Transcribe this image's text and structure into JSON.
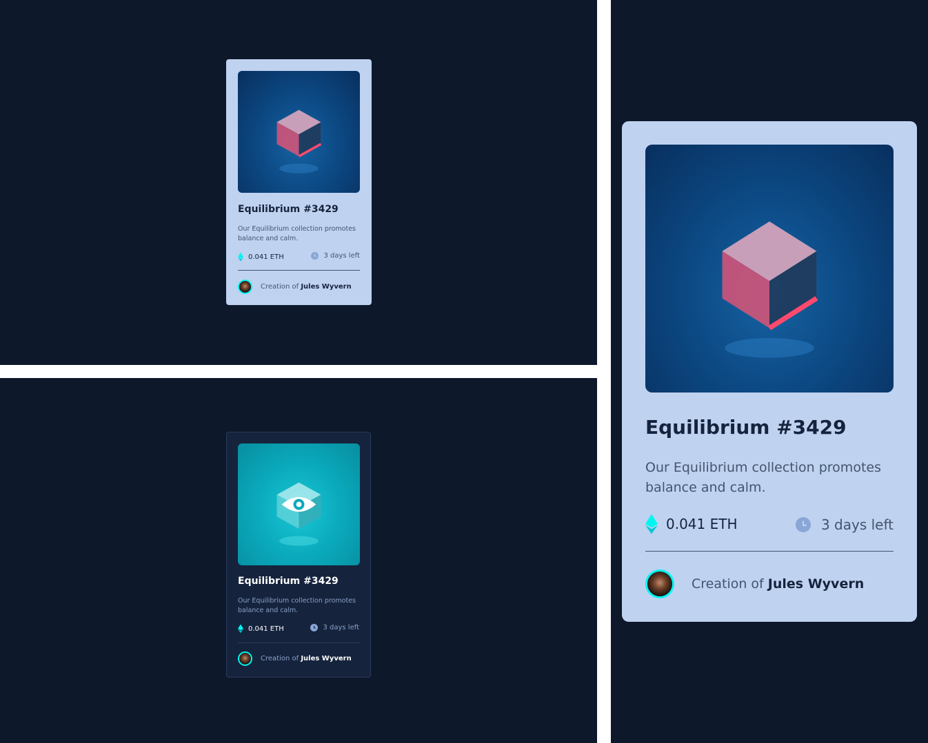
{
  "card": {
    "title": "Equilibrium #3429",
    "description": "Our Equilibrium collection promotes balance and calm.",
    "price": "0.041 ETH",
    "time_left": "3 days left",
    "creator_prefix": "Creation of",
    "creator_name": "Jules Wyvern",
    "icons": [
      "ethereum-icon",
      "clock-icon",
      "view-eye-icon"
    ],
    "colors": {
      "page_background": "#0e182b",
      "card_light": "#bfd2f0",
      "card_dark": "#15233d",
      "accent_cyan": "#00f6f0",
      "text_dark": "#15233d",
      "text_muted": "#44546e"
    }
  }
}
